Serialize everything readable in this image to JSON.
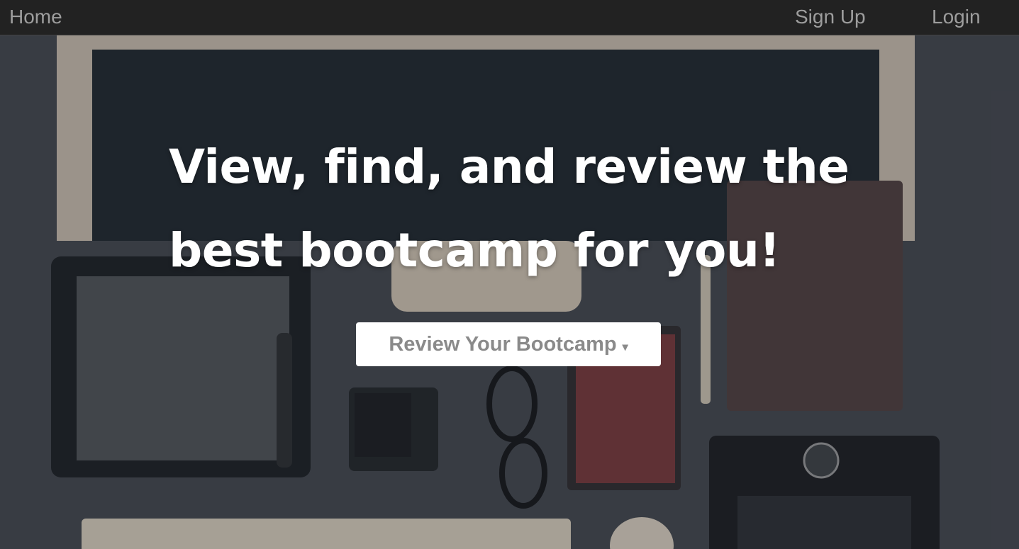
{
  "nav": {
    "home_label": "Home",
    "signup_label": "Sign Up",
    "login_label": "Login"
  },
  "hero": {
    "headline_line1": "View, find, and review the",
    "headline_line2": "best bootcamp for you!",
    "cta_label": "Review Your Bootcamp",
    "cta_caret": "▾"
  },
  "colors": {
    "navbar_bg": "#222222",
    "nav_text": "#9d9d9d",
    "headline_text": "#ffffff",
    "cta_bg": "#ffffff",
    "cta_text": "#8a8a8a",
    "desk_bg": "#3d4048"
  },
  "background_image": "desk-flatlay-photo"
}
